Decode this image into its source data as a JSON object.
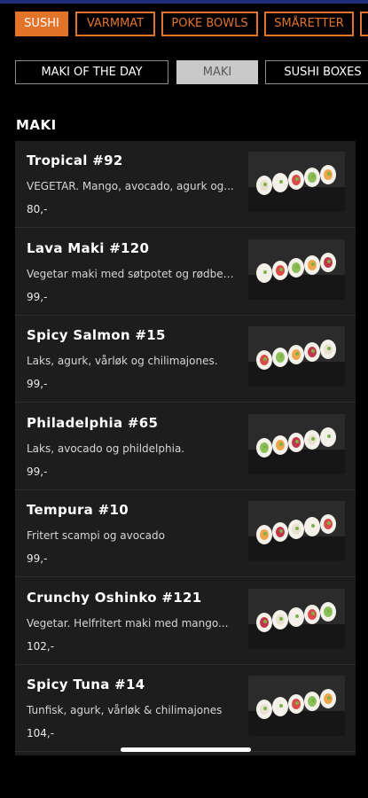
{
  "categories": [
    {
      "label": "SUSHI",
      "active": true
    },
    {
      "label": "VARMMAT",
      "active": false
    },
    {
      "label": "POKE BOWLS",
      "active": false
    },
    {
      "label": "SMÅRETTER",
      "active": false
    },
    {
      "label": "",
      "active": false
    }
  ],
  "subcategories": [
    {
      "label": "MAKI OF THE DAY",
      "active": false
    },
    {
      "label": "MAKI",
      "active": true
    },
    {
      "label": "SUSHI BOXES",
      "active": false
    }
  ],
  "section_title": "MAKI",
  "items": [
    {
      "name": "Tropical #92",
      "desc": "VEGETAR. Mango, avocado, agurk og...",
      "price": "80,-",
      "image": "sushi-roll-photo"
    },
    {
      "name": "Lava Maki #120",
      "desc": "Vegetar maki med søtpotet og rødbete...",
      "price": "99,-",
      "image": "sushi-roll-photo"
    },
    {
      "name": "Spicy Salmon #15",
      "desc": "Laks, agurk, vårløk og chilimajones.",
      "price": "99,-",
      "image": "sushi-roll-photo"
    },
    {
      "name": "Philadelphia #65",
      "desc": "Laks, avocado og phildelphia.",
      "price": "99,-",
      "image": "sushi-roll-photo"
    },
    {
      "name": "Tempura #10",
      "desc": "Fritert scampi og avocado",
      "price": "99,-",
      "image": "sushi-roll-photo"
    },
    {
      "name": "Crunchy Oshinko #121",
      "desc": "Vegetar. Helfritert maki med mango...",
      "price": "102,-",
      "image": "sushi-roll-photo"
    },
    {
      "name": "Spicy Tuna #14",
      "desc": "Tunfisk, agurk, vårløk & chilimajones",
      "price": "104,-",
      "image": "sushi-roll-photo"
    }
  ],
  "colors": {
    "accent": "#e2742a",
    "background": "#000000",
    "card": "#1d1d1d",
    "active_sub": "#c9c9c9"
  }
}
